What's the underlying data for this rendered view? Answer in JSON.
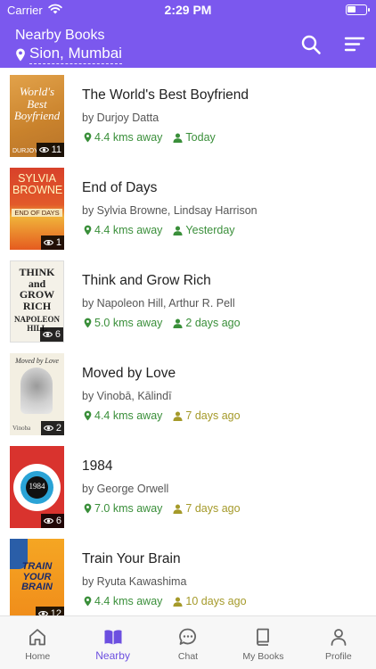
{
  "status_bar": {
    "carrier": "Carrier",
    "time": "2:29 PM"
  },
  "header": {
    "title": "Nearby Books",
    "location": "Sion, Mumbai"
  },
  "books": [
    {
      "title": "The World's Best Boyfriend",
      "author": "by Durjoy Datta",
      "distance": "4.4 kms away",
      "when": "Today",
      "views": "11",
      "cover_text": "World's Best Boyfriend",
      "cover_bottom": "DURJOY"
    },
    {
      "title": "End of Days",
      "author": "by Sylvia Browne, Lindsay Harrison",
      "distance": "4.4 kms away",
      "when": "Yesterday",
      "views": "1",
      "cover_text": "SYLVIA BROWNE",
      "cover_bottom": "END OF DAYS"
    },
    {
      "title": "Think and Grow Rich",
      "author": "by Napoleon Hill, Arthur R. Pell",
      "distance": "5.0 kms away",
      "when": "2 days ago",
      "views": "6",
      "cover_text": "THINK and GROW RICH",
      "cover_bottom": "NAPOLEON HILL"
    },
    {
      "title": "Moved by Love",
      "author": "by Vinobā, Kālindī",
      "distance": "4.4 kms away",
      "when": "7 days ago",
      "views": "2",
      "cover_text": "Moved by Love",
      "cover_bottom": "Vinoba"
    },
    {
      "title": "1984",
      "author": "by George Orwell",
      "distance": "7.0 kms away",
      "when": "7 days ago",
      "views": "6",
      "cover_text": "1984",
      "cover_bottom": ""
    },
    {
      "title": "Train Your Brain",
      "author": "by Ryuta Kawashima",
      "distance": "4.4 kms away",
      "when": "10 days ago",
      "views": "12",
      "cover_text": "TRAIN YOUR BRAIN",
      "cover_bottom": ""
    }
  ],
  "tabs": [
    {
      "label": "Home",
      "icon": "home-icon"
    },
    {
      "label": "Nearby",
      "icon": "book-open-icon"
    },
    {
      "label": "Chat",
      "icon": "chat-icon"
    },
    {
      "label": "My Books",
      "icon": "book-icon"
    },
    {
      "label": "Profile",
      "icon": "user-icon"
    }
  ],
  "colors": {
    "header": "#7b58ee",
    "accent": "#6c4fe0",
    "distance": "#3a8f3a",
    "older": "#a59a2a"
  }
}
